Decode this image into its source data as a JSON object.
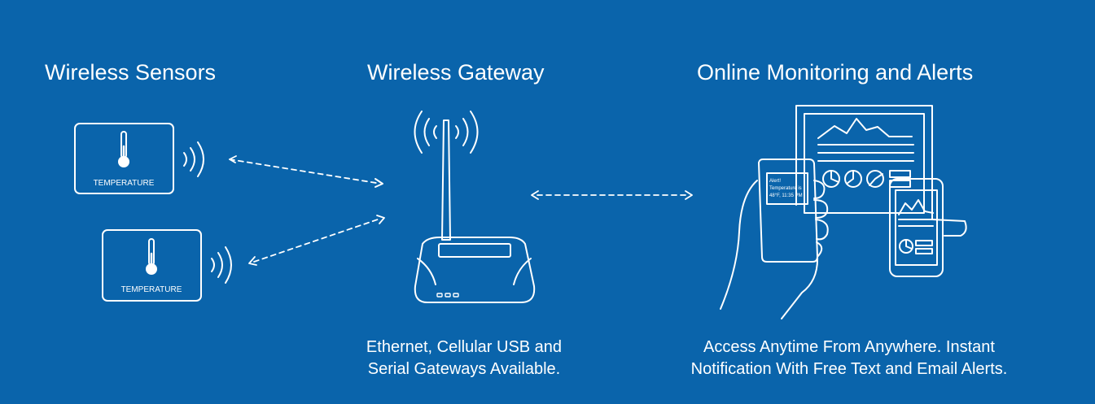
{
  "headings": {
    "sensors": "Wireless Sensors",
    "gateway": "Wireless Gateway",
    "monitoring": "Online Monitoring and Alerts"
  },
  "sensors": [
    {
      "label": "TEMPERATURE"
    },
    {
      "label": "TEMPERATURE"
    }
  ],
  "captions": {
    "gateway": [
      "Ethernet, Cellular USB and",
      "Serial Gateways Available."
    ],
    "monitoring": [
      "Access Anytime From Anywhere. Instant",
      "Notification With Free Text and Email Alerts."
    ]
  },
  "phone_alert": [
    "Alert!",
    "Temperature is",
    "48°F, 11:35 PM"
  ],
  "colors": {
    "background": "#0a64ab",
    "line": "#ffffff"
  }
}
